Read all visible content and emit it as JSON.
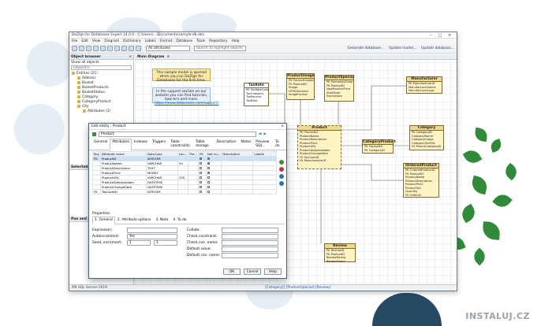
{
  "window": {
    "title": "DeZign for Databases Expert 14.0.0 - C:\\Users\\...\\Documents\\sample-db.dez"
  },
  "menu": [
    "File",
    "Edit",
    "View",
    "Diagram",
    "Dictionary",
    "Labels",
    "Format",
    "Database",
    "Tools",
    "Repository",
    "Help"
  ],
  "toolbar": {
    "filter_value": "All attributes",
    "search_placeholder": "Search to highlight objects",
    "links": [
      "Generate database...",
      "Update model...",
      "Update database..."
    ]
  },
  "object_browser": {
    "title": "Object browser",
    "show_label": "Show all objects",
    "search": "<Search>",
    "tree": [
      {
        "label": "Entities (21)",
        "level": 0
      },
      {
        "label": "Address",
        "level": 1
      },
      {
        "label": "Basket",
        "level": 1
      },
      {
        "label": "BasketProducts",
        "level": 1
      },
      {
        "label": "BasketStatus",
        "level": 1
      },
      {
        "label": "Category",
        "level": 1
      },
      {
        "label": "CategoryProduct",
        "level": 1
      },
      {
        "label": "City",
        "level": 1
      },
      {
        "label": "Attributes (2)",
        "level": 2
      }
    ],
    "selected_objects_title": "Selected objects",
    "pan_zoom_title": "Pan and zoom"
  },
  "diagram": {
    "tab": "Main Diagram",
    "info_yellow": "This sample model is opened when you run DeZign for Databases for the first time.",
    "info_blue_1": "In the support section on our website you can find tutorials, how-to's and more.",
    "info_blue_2": "https://www.datanamic.com/support/",
    "entities": [
      {
        "name": "TaxRate",
        "attrs": [
          "PK  TaxRateCode",
          "     TaxCategory",
          "     TaxPercent",
          "     TaxRate"
        ]
      },
      {
        "name": "ProductImage",
        "attrs": [
          "PK  ProductImageID",
          "FK  ProductID",
          "     Image",
          "     HTMLElement",
          "     ImageFormat"
        ]
      },
      {
        "name": "ProductSpecial",
        "attrs": [
          "PK  PromotionCode",
          "FK  ProductID",
          "     NewProductPrice",
          "     StartDate",
          "     ExpiryDate"
        ]
      },
      {
        "name": "Product",
        "attrs": [
          "PK  ProductID",
          "     ProductName",
          "     ProductDescription",
          "     ProductPrice",
          "     ProductURL",
          "     ProductDateAvailable",
          "     ProductChangeDate",
          "FK  TaxCodeID",
          "FK  ManufacturerID"
        ]
      },
      {
        "name": "CategoryProduct",
        "attrs": [
          "PK  ProductID",
          "PK  CategoryID"
        ]
      },
      {
        "name": "Manufacturer",
        "attrs": [
          "PK  ManufacturerID",
          "     ManufacturerName",
          "     ManufacturerLogo"
        ]
      },
      {
        "name": "Category",
        "attrs": [
          "PK  CategoryID",
          "     CategoryName",
          "     CategoryImage",
          "     CategoryTextFile",
          "FK  ParentCategoryID"
        ]
      },
      {
        "name": "OrderedProduct",
        "attrs": [
          "PK  OrderedProductID",
          "FK  ProductID",
          "     ProductName",
          "     ProductDescription",
          "     ProductPrice",
          "     ProductTax",
          "     Quantity",
          "FK  OrderID"
        ]
      },
      {
        "name": "Review",
        "attrs": [
          "PK  ReviewID",
          "FK  ProductID",
          "     ReviewRating",
          "     ReviewStatus"
        ]
      }
    ]
  },
  "status": {
    "db": "MS SQL Server 2019",
    "breadcrumb": "[Category]] [ProductSpecial] [Review]"
  },
  "dialog": {
    "title": "Edit entity : Product",
    "name_value": "Product",
    "tabs": [
      "General",
      "Attributes",
      "Indexes",
      "Triggers",
      "Table constraints",
      "Table storage",
      "Description",
      "Notes",
      "Preview SQL",
      "To do"
    ],
    "columns": [
      "Key",
      "Attribute name",
      "Data type",
      "Len...",
      "Pre...",
      "PK",
      "Not nu...",
      "Description",
      "Labels"
    ],
    "rows": [
      {
        "key": "PK",
        "name": "ProductID",
        "type": "INTEGER",
        "len": "",
        "pre": "",
        "pk": true,
        "nn": true,
        "sel": true
      },
      {
        "key": "",
        "name": "ProductName",
        "type": "VARCHAR",
        "len": "50",
        "pre": "",
        "pk": false,
        "nn": true,
        "sel": false
      },
      {
        "key": "",
        "name": "ProductDescription",
        "type": "TEXT",
        "len": "",
        "pre": "",
        "pk": false,
        "nn": false,
        "sel": false
      },
      {
        "key": "",
        "name": "ProductPrice",
        "type": "MONEY",
        "len": "",
        "pre": "",
        "pk": false,
        "nn": true,
        "sel": false
      },
      {
        "key": "",
        "name": "ProductURL",
        "type": "VARCHAR",
        "len": "255",
        "pre": "",
        "pk": false,
        "nn": false,
        "sel": false
      },
      {
        "key": "",
        "name": "ProductDateAvailable",
        "type": "DATETIME",
        "len": "",
        "pre": "",
        "pk": false,
        "nn": false,
        "sel": false
      },
      {
        "key": "",
        "name": "ProductChangeDate",
        "type": "DATETIME",
        "len": "",
        "pre": "",
        "pk": false,
        "nn": false,
        "sel": false
      },
      {
        "key": "FK",
        "name": "TaxCodeID",
        "type": "INTEGER",
        "len": "",
        "pre": "",
        "pk": false,
        "nn": false,
        "sel": false
      }
    ],
    "properties_title": "Properties",
    "prop_tabs": [
      "1. General",
      "2. Attribute options",
      "3. Note",
      "4. To do"
    ],
    "prop_left": [
      {
        "label": "Expression:",
        "value": ""
      },
      {
        "label": "Autoincrement:",
        "value": "Yes"
      },
      {
        "label": "Seed, increment:",
        "value": "1"
      }
    ],
    "increment_value": "1",
    "prop_right": [
      {
        "label": "Collate:"
      },
      {
        "label": "Check constraint:"
      },
      {
        "label": "Check con. name:"
      },
      {
        "label": "Default value:"
      },
      {
        "label": "Default con. name:"
      }
    ],
    "buttons": {
      "ok": "OK",
      "cancel": "Cancel",
      "help": "Help"
    }
  },
  "watermark": "INSTALUJ.CZ",
  "colors": {
    "entity_fill": "#fff3c4",
    "entity_border": "#7f6c34",
    "accent": "#264a63",
    "leaf": "#2f8a3a"
  }
}
